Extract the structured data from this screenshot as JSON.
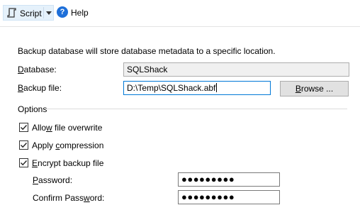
{
  "toolbar": {
    "script_label": "Script",
    "help_label": "Help"
  },
  "description": "Backup database will store database metadata to a specific location.",
  "database": {
    "label_prefix": "",
    "label_accel": "D",
    "label_rest": "atabase:",
    "value": "SQLShack"
  },
  "backup_file": {
    "label_prefix": "",
    "label_accel": "B",
    "label_rest": "ackup file:",
    "value": "D:\\Temp\\SQLShack.abf",
    "browse_accel": "B",
    "browse_rest": "rowse ..."
  },
  "options": {
    "heading": "Options",
    "allow_overwrite": {
      "prefix": "Allo",
      "accel": "w",
      "rest": " file overwrite",
      "checked": true
    },
    "apply_compression": {
      "prefix": "Apply ",
      "accel": "c",
      "rest": "ompression",
      "checked": true
    },
    "encrypt_backup": {
      "prefix": "",
      "accel": "E",
      "rest": "ncrypt backup file",
      "checked": true
    }
  },
  "password": {
    "label_prefix": "",
    "label_accel": "P",
    "label_rest": "assword:",
    "value": "●●●●●●●●●"
  },
  "confirm_password": {
    "label_prefix": "Confirm Pass",
    "label_accel": "w",
    "label_rest": "ord:",
    "value": "●●●●●●●●●"
  }
}
